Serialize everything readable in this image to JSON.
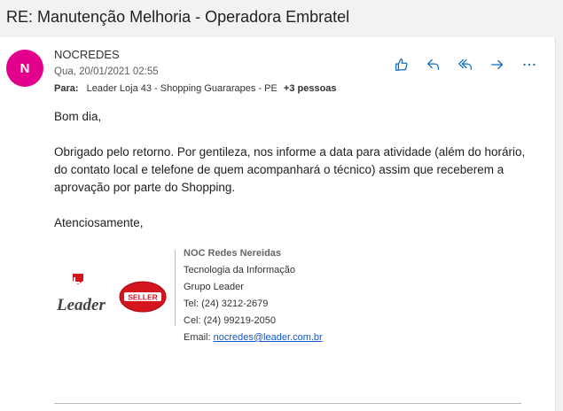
{
  "message": {
    "subject": "RE: Manutenção Melhoria - Operadora Embratel",
    "avatar_initial": "N",
    "avatar_color": "#e3008c",
    "sender": "NOCREDES",
    "date": "Qua, 20/01/2021 02:55",
    "to_label": "Para:",
    "to": "Leader Loja 43 - Shopping Guararapes - PE",
    "to_more": "+3 pessoas"
  },
  "actions": [
    {
      "name": "like-icon"
    },
    {
      "name": "reply-icon"
    },
    {
      "name": "reply-all-icon"
    },
    {
      "name": "forward-icon"
    },
    {
      "name": "more-icon"
    }
  ],
  "body": {
    "greeting": "Bom dia,",
    "paragraph": "Obrigado pelo retorno. Por gentileza, nos informe a data para atividade (além do horário, do contato local e telefone de quem acompanhará o técnico) assim que receberem a aprovação por parte do Shopping.",
    "closing": "Atenciosamente,"
  },
  "signature": {
    "name": "NOC Redes Nereidas",
    "department": "Tecnologia da Informação",
    "company": "Grupo Leader",
    "tel": "Tel: (24) 3212-2679",
    "cel": "Cel: (24) 99219-2050",
    "email_label": "Email:",
    "email": "nocredes@leader.com.br",
    "logo_leader_text": "Leader",
    "logo_seller_text": "SELLER"
  }
}
